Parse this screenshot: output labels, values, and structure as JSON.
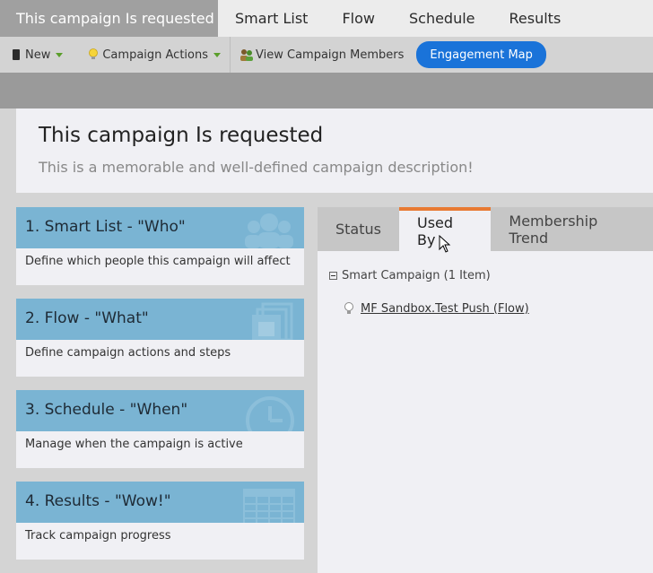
{
  "topnav": {
    "active_tab": "This campaign Is requested",
    "tabs": [
      "Smart List",
      "Flow",
      "Schedule",
      "Results"
    ]
  },
  "toolbar": {
    "new_label": "New",
    "actions_label": "Campaign Actions",
    "members_label": "View Campaign Members",
    "engagement_label": "Engagement Map"
  },
  "header": {
    "title": "This campaign Is requested",
    "description": "This is a memorable and well-defined campaign description!"
  },
  "cards": [
    {
      "title": "1. Smart List - \"Who\"",
      "desc": "Define which people this campaign will affect",
      "icon": "people-icon"
    },
    {
      "title": "2. Flow - \"What\"",
      "desc": "Define campaign actions and steps",
      "icon": "stacked-pages-icon"
    },
    {
      "title": "3. Schedule - \"When\"",
      "desc": "Manage when the campaign is active",
      "icon": "clock-icon"
    },
    {
      "title": "4. Results - \"Wow!\"",
      "desc": "Track campaign progress",
      "icon": "table-icon"
    }
  ],
  "panel": {
    "tabs": [
      "Status",
      "Used By",
      "Membership Trend"
    ],
    "active_tab": "Used By",
    "group_label": "Smart Campaign (1 Item)",
    "item_link": "MF Sandbox.Test Push (Flow)"
  },
  "colors": {
    "accent_blue": "#1a73d9",
    "card_header": "#7ab4d3",
    "tab_underline": "#e87a32"
  }
}
